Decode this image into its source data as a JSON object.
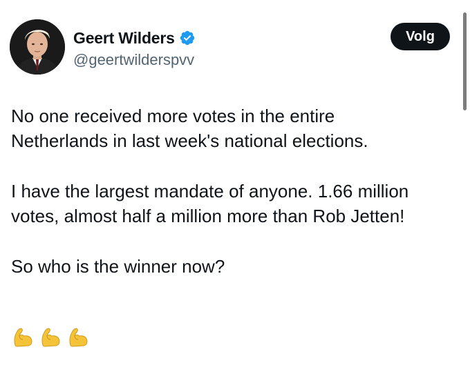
{
  "author": {
    "display_name": "Geert Wilders",
    "handle": "@geertwilderspvv",
    "verified": true,
    "verified_color": "#1d9bf0"
  },
  "follow_button": {
    "label": "Volg"
  },
  "tweet": {
    "paragraphs": [
      "No one received more votes in the entire\nNetherlands in last week's national elections.",
      "I have the largest mandate of anyone. 1.66 million\nvotes, almost half a million more than Rob Jetten!",
      "So who is the winner now?"
    ],
    "emojis": [
      "flexed-biceps-icon",
      "flexed-biceps-icon",
      "flexed-biceps-icon"
    ]
  },
  "colors": {
    "text_primary": "#0f1419",
    "text_secondary": "#536471",
    "button_bg": "#0f1419",
    "emoji_yellow": "#f4c33a"
  }
}
